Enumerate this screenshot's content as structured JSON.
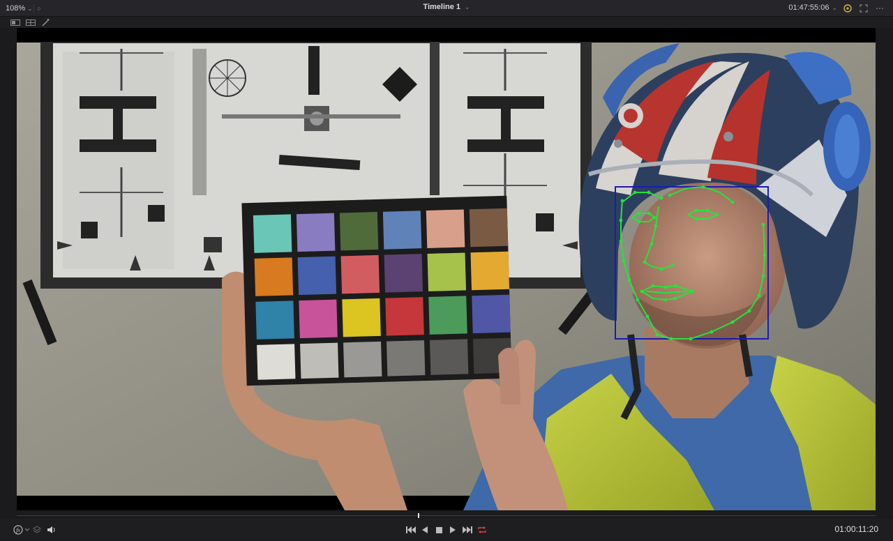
{
  "header": {
    "zoom_value": "108%",
    "timeline_title": "Timeline 1",
    "record_timecode": "01:47:55:06"
  },
  "transport": {
    "current_timecode": "01:00:11:20",
    "loop_active": true
  },
  "icons": {
    "zoom_dropdown": "chevron-down-icon",
    "title_dropdown": "chevron-down-icon",
    "timecode_dropdown": "chevron-down-icon",
    "color_picker": "color-dropper-icon",
    "fullscreen": "expand-icon",
    "more_options": "more-options-icon",
    "single_viewer": "single-viewer-icon",
    "dual_viewer": "split-viewer-icon",
    "magic_mask": "magic-wand-icon",
    "fx_overlay": "fx-icon",
    "layers": "layers-icon",
    "audio": "speaker-icon",
    "first_frame": "skip-to-start-icon",
    "play_reverse": "play-reverse-icon",
    "stop": "stop-icon",
    "play": "play-icon",
    "last_frame": "skip-to-end-icon",
    "loop": "loop-icon"
  },
  "colors": {
    "face_landmarks": "#27e23c",
    "face_box": "#1b1bb0",
    "loop_active": "#e0453a"
  }
}
